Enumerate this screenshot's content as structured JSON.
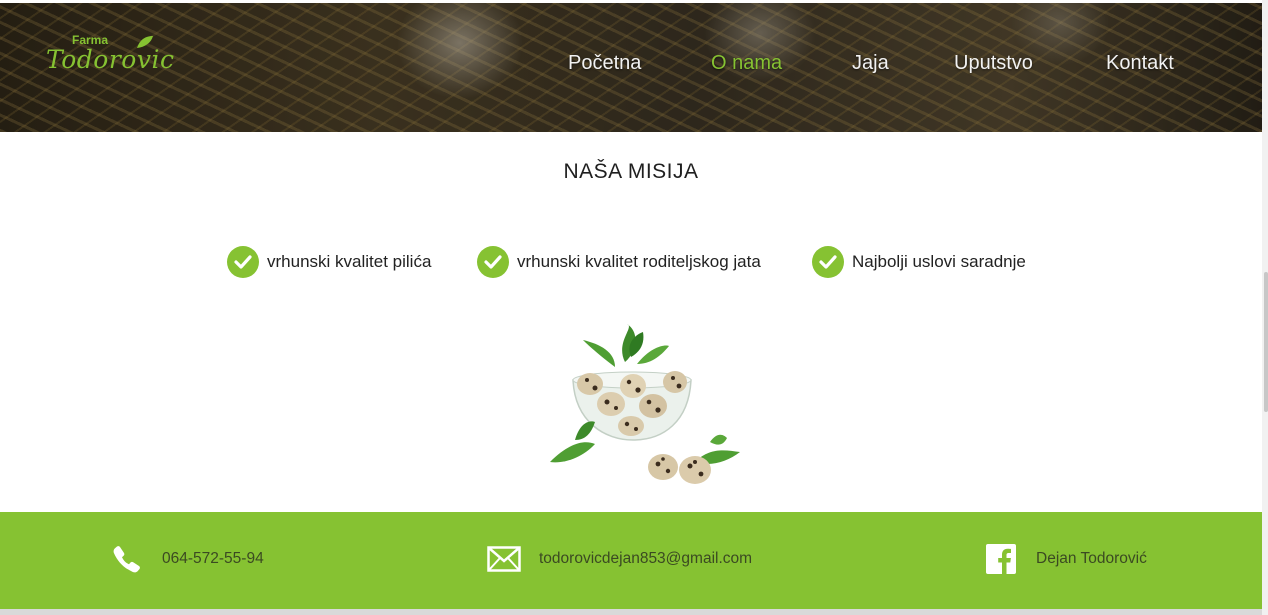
{
  "header": {
    "logo_small": "Farma",
    "logo_big": "Todorovic",
    "nav": [
      {
        "label": "Početna",
        "active": false
      },
      {
        "label": "O nama",
        "active": true
      },
      {
        "label": "Jaja",
        "active": false
      },
      {
        "label": "Uputstvo",
        "active": false
      },
      {
        "label": "Kontakt",
        "active": false
      }
    ]
  },
  "mission": {
    "title": "NAŠA MISIJA",
    "features": [
      {
        "label": "vrhunski kvalitet pilića",
        "icon": "check-circle-icon"
      },
      {
        "label": "vrhunski kvalitet roditeljskog jata",
        "icon": "check-circle-icon"
      },
      {
        "label": "Najbolji uslovi saradnje",
        "icon": "check-circle-icon"
      }
    ]
  },
  "footer": {
    "phone": "064-572-55-94",
    "email": "todorovicdejan853@gmail.com",
    "facebook": "Dejan Todorović"
  },
  "colors": {
    "accent": "#86c232",
    "text": "#222222",
    "footer_text": "#3b4a22"
  }
}
